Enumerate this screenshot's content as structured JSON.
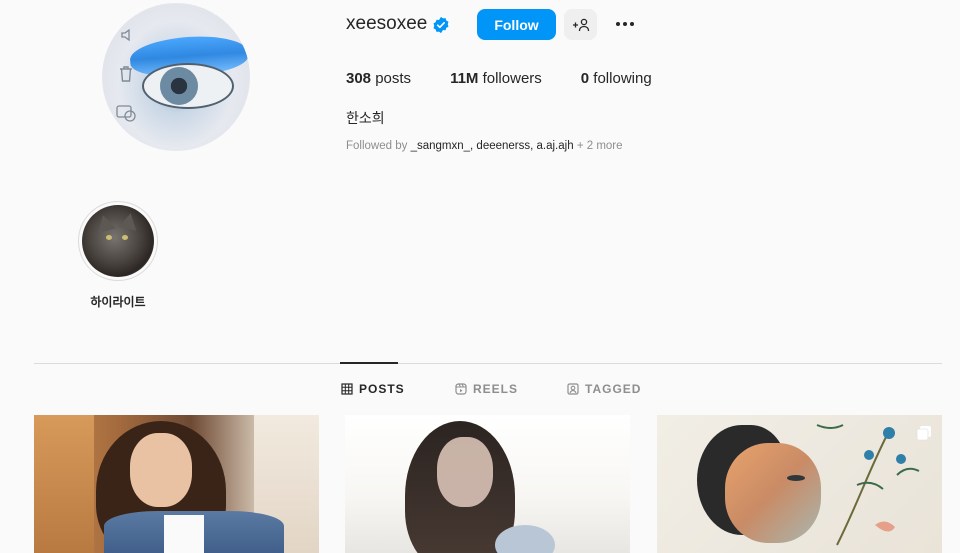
{
  "profile": {
    "username": "xeesoxee",
    "verified": true,
    "follow_label": "Follow",
    "stats": {
      "posts_count": "308",
      "posts_label": "posts",
      "followers_count": "11M",
      "followers_label": "followers",
      "following_count": "0",
      "following_label": "following"
    },
    "bio_name": "한소희",
    "followed_by": {
      "prefix": "Followed by",
      "users": "_sangmxn_, deeenerss, a.aj.ajh",
      "more": "+ 2 more"
    }
  },
  "highlights": [
    {
      "label": "하이라이트"
    }
  ],
  "tabs": [
    {
      "label": "POSTS",
      "icon": "grid-icon",
      "active": true
    },
    {
      "label": "REELS",
      "icon": "reels-icon",
      "active": false
    },
    {
      "label": "TAGGED",
      "icon": "tagged-icon",
      "active": false
    }
  ],
  "colors": {
    "accent": "#0095f6",
    "verified": "#0095f6",
    "text": "#262626",
    "muted": "#8e8e8e",
    "background": "#fafafa"
  }
}
